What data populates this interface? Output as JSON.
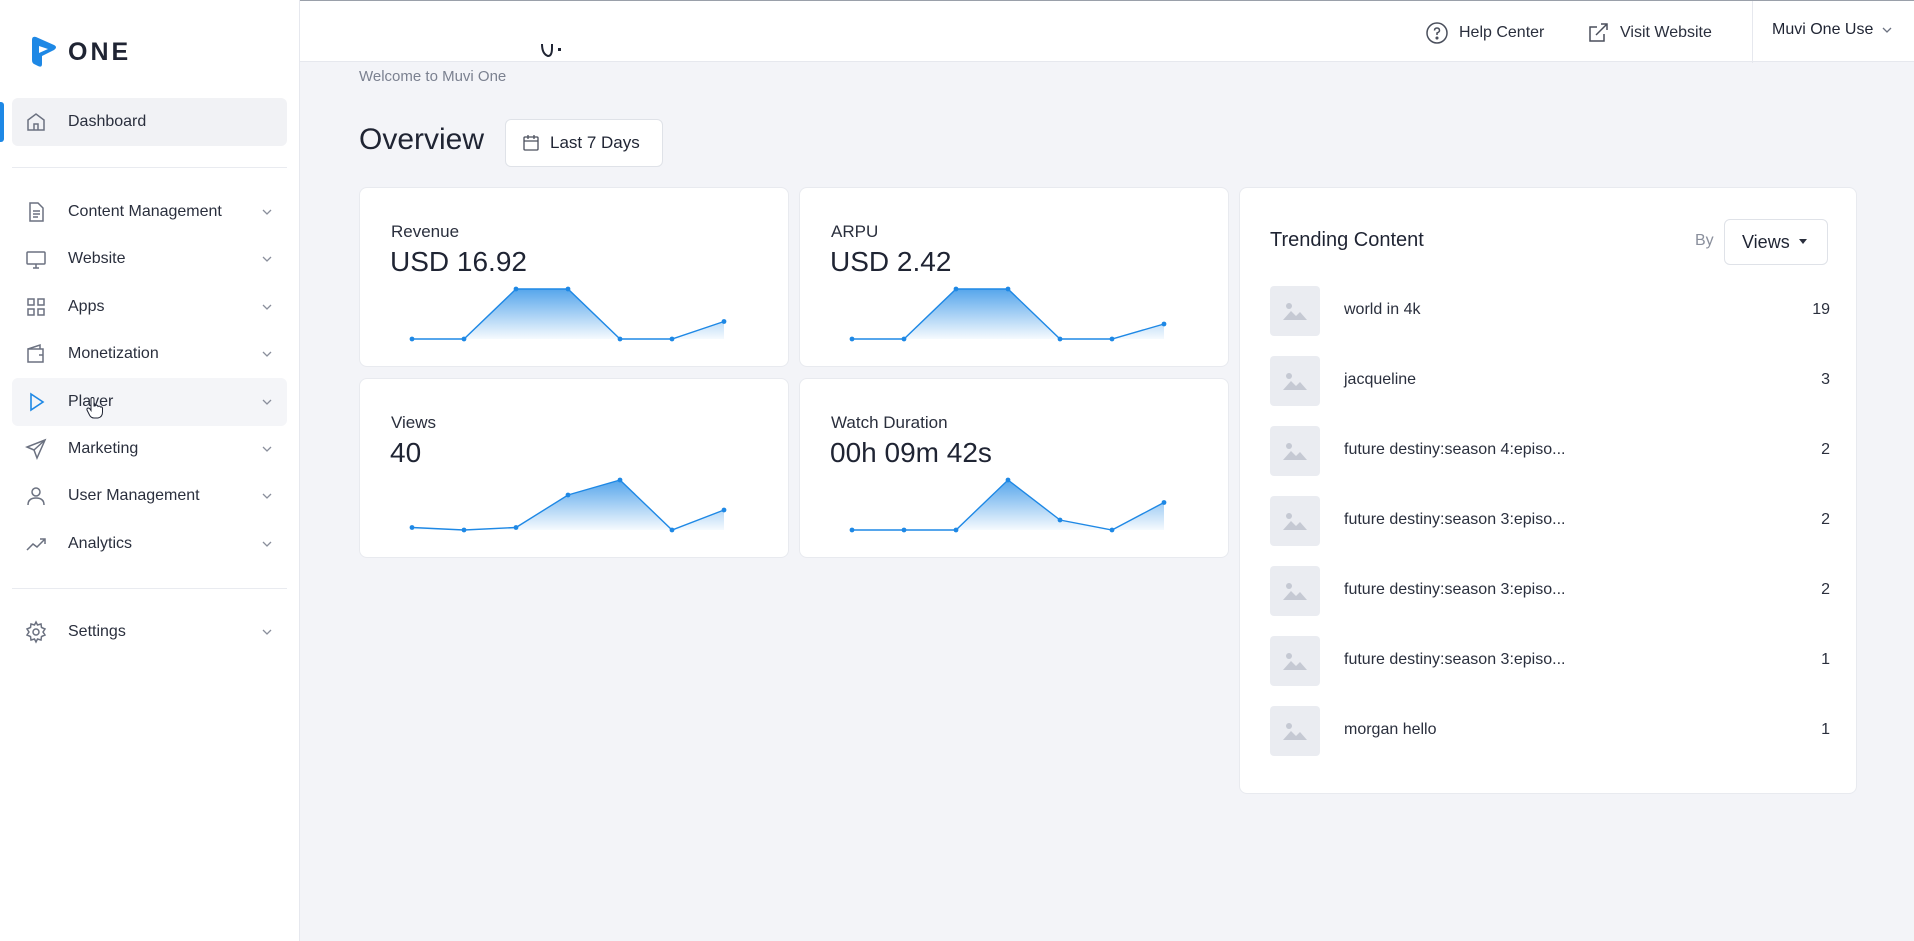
{
  "brand": {
    "logo_text": "ONE",
    "accent": "#1e88e5"
  },
  "sidebar": {
    "items": [
      {
        "label": "Dashboard",
        "icon": "home-icon"
      },
      {
        "label": "Content Management",
        "icon": "document-icon"
      },
      {
        "label": "Website",
        "icon": "monitor-icon"
      },
      {
        "label": "Apps",
        "icon": "grid-icon"
      },
      {
        "label": "Monetization",
        "icon": "wallet-icon"
      },
      {
        "label": "Player",
        "icon": "play-icon"
      },
      {
        "label": "Marketing",
        "icon": "send-icon"
      },
      {
        "label": "User Management",
        "icon": "user-icon"
      },
      {
        "label": "Analytics",
        "icon": "trending-up-icon"
      },
      {
        "label": "Settings",
        "icon": "gear-icon"
      }
    ]
  },
  "topbar": {
    "help_label": "Help Center",
    "visit_label": "Visit Website",
    "user_label": "Muvi One Use"
  },
  "header": {
    "welcome": "Welcome to Muvi One",
    "overview": "Overview",
    "date_range": "Last 7 Days"
  },
  "cards": [
    {
      "title": "Revenue",
      "value": "USD 16.92",
      "trend": [
        0,
        0,
        1,
        1,
        0,
        0,
        0.35
      ]
    },
    {
      "title": "ARPU",
      "value": "USD 2.42",
      "trend": [
        0,
        0,
        1,
        1,
        0,
        0,
        0.3
      ]
    },
    {
      "title": "Views",
      "value": "40",
      "trend": [
        0.05,
        0,
        0.05,
        0.7,
        1,
        0,
        0.4
      ]
    },
    {
      "title": "Watch Duration",
      "value": "00h 09m 42s",
      "trend": [
        0,
        0,
        0,
        1,
        0.2,
        0,
        0.55
      ]
    }
  ],
  "trending": {
    "title": "Trending Content",
    "by_label": "By",
    "sort_label": "Views",
    "items": [
      {
        "name": "world in 4k",
        "count": "19"
      },
      {
        "name": "jacqueline",
        "count": "3"
      },
      {
        "name": "future destiny:season 4:episo...",
        "count": "2"
      },
      {
        "name": "future destiny:season 3:episo...",
        "count": "2"
      },
      {
        "name": "future destiny:season 3:episo...",
        "count": "2"
      },
      {
        "name": "future destiny:season 3:episo...",
        "count": "1"
      },
      {
        "name": "morgan hello",
        "count": "1"
      }
    ]
  }
}
